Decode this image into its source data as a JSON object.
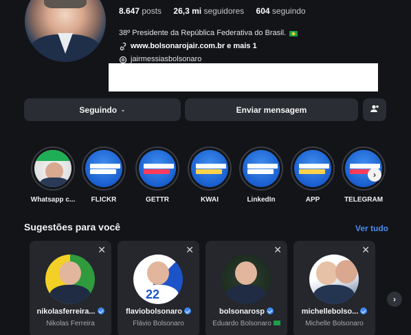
{
  "profile": {
    "stats": [
      {
        "value": "8.647",
        "label": "posts"
      },
      {
        "value": "26,3 mi",
        "label": "seguidores"
      },
      {
        "value": "604",
        "label": "seguindo"
      }
    ],
    "bio": "38º Presidente da República Federativa do Brasil.",
    "link": "www.bolsonarojair.com.br e mais 1",
    "threads_handle": "jairmessiasbolsonaro"
  },
  "actions": {
    "following_label": "Seguindo",
    "message_label": "Enviar mensagem"
  },
  "highlights": [
    {
      "label": "Whatsapp c...",
      "style": "wa"
    },
    {
      "label": "FLICKR",
      "style": "blue"
    },
    {
      "label": "GETTR",
      "style": "blue-red"
    },
    {
      "label": "KWAI",
      "style": "blue-gold"
    },
    {
      "label": "LinkedIn",
      "style": "blue"
    },
    {
      "label": "APP",
      "style": "blue"
    },
    {
      "label": "TELEGRAM",
      "style": "blue-red"
    }
  ],
  "suggestions": {
    "title": "Sugestões para você",
    "see_all": "Ver tudo",
    "cards": [
      {
        "username": "nikolasferreira...",
        "name": "Nikolas Ferreira"
      },
      {
        "username": "flaviobolsonaro",
        "name": "Flávio Bolsonaro"
      },
      {
        "username": "bolsonarosp",
        "name": "Eduardo Bolsonaro"
      },
      {
        "username": "michellebolso...",
        "name": "Michelle Bolsonaro"
      }
    ]
  },
  "colors": {
    "background": "#121418",
    "button": "#2a2d33",
    "link_accent": "#4d8df6",
    "verified": "#3d8af5"
  }
}
